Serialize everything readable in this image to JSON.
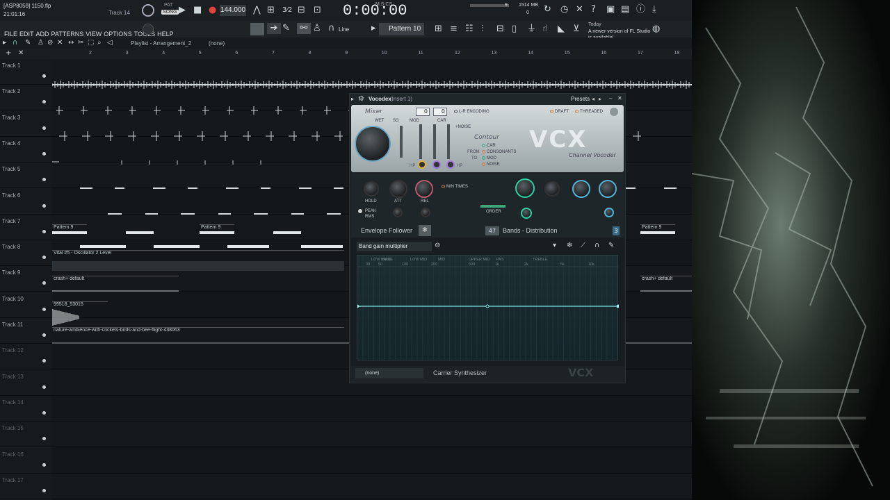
{
  "titlebar": {
    "project": "[ASP8059] 1150.flp",
    "time": "21:01:16",
    "track_hint": "Track 14",
    "pat_label": "PAT",
    "song_label": "SONG",
    "tempo": "144.000",
    "time_display": "0:00:00",
    "time_unit": "M:S:CS",
    "cpu": "9",
    "mem": "1514 MB",
    "poly": "0"
  },
  "menu": [
    "FILE",
    "EDIT",
    "ADD",
    "PATTERNS",
    "VIEW",
    "OPTIONS",
    "TOOLS",
    "HELP"
  ],
  "toolbar": {
    "snap_mode": "Line",
    "pattern": "Pattern 10",
    "news_date": "Today",
    "news_text": "A newer version of FL Studio is available!"
  },
  "playlist": {
    "title": "Playlist - Arrangement_2",
    "selected": "(none)"
  },
  "ruler": [
    "2",
    "3",
    "4",
    "5",
    "6",
    "7",
    "8",
    "9",
    "10",
    "11",
    "12",
    "13",
    "14",
    "15",
    "16",
    "17",
    "18"
  ],
  "tracks": [
    "Track 1",
    "Track 2",
    "Track 3",
    "Track 4",
    "Track 5",
    "Track 6",
    "Track 7",
    "Track 8",
    "Track 9",
    "Track 10",
    "Track 11",
    "Track 12",
    "Track 13",
    "Track 14",
    "Track 15",
    "Track 16",
    "Track 17"
  ],
  "clips": {
    "t7a": "Pattern 9",
    "t7b": "Pattern 9",
    "t7c": "Pattern 9",
    "t8": "Vital #5 - Oscillator 2 Level",
    "t9": "crash+ default",
    "t9b": "crash+ default",
    "t10": "99518_53015",
    "t11": "nature-ambience-with-crickets-birds-and-bee-flight-438063"
  },
  "plugin": {
    "title": "Vocodex",
    "insert": "(Insert 1)",
    "presets": "Presets",
    "mixer": "Mixer",
    "wet": "WET",
    "sg": "SG",
    "mod": "MOD",
    "car": "CAR",
    "noise": "+NOISE",
    "hp": "HP",
    "hp2": "HP",
    "val1": "0",
    "val2": "0",
    "lr": "L-R ENCODING",
    "draft": "DRAFT",
    "threaded": "THREADED",
    "contour": "Contour",
    "from": "FROM",
    "to": "TO",
    "opt_car": "CAR",
    "opt_cons": "CONSONANTS",
    "opt_mod": "MOD",
    "opt_noise": "NOISE",
    "logo": "VCX",
    "subtitle": "Channel Vocoder",
    "hold": "HOLD",
    "att": "ATT",
    "rel": "REL",
    "min_times": "MIN TIMES",
    "peak": "PEAK",
    "rms": "RMS",
    "order": "ORDER",
    "env_follower": "Envelope Follower",
    "bands_count": "47",
    "bands": "Bands - Distribution",
    "bands_right": "3",
    "band_select": "Band gain multiplier",
    "freq_groups": [
      "LOW BASS",
      "BASS",
      "LOW MID",
      "MID",
      "UPPER MID",
      "PAS",
      "TREBLE"
    ],
    "freq_ticks": [
      "30",
      "50",
      "100",
      "200",
      "500",
      "1k",
      "2k",
      "5k",
      "10k"
    ],
    "carrier_select": "(none)",
    "carrier_label": "Carrier Synthesizer",
    "watermark": "VCX"
  }
}
